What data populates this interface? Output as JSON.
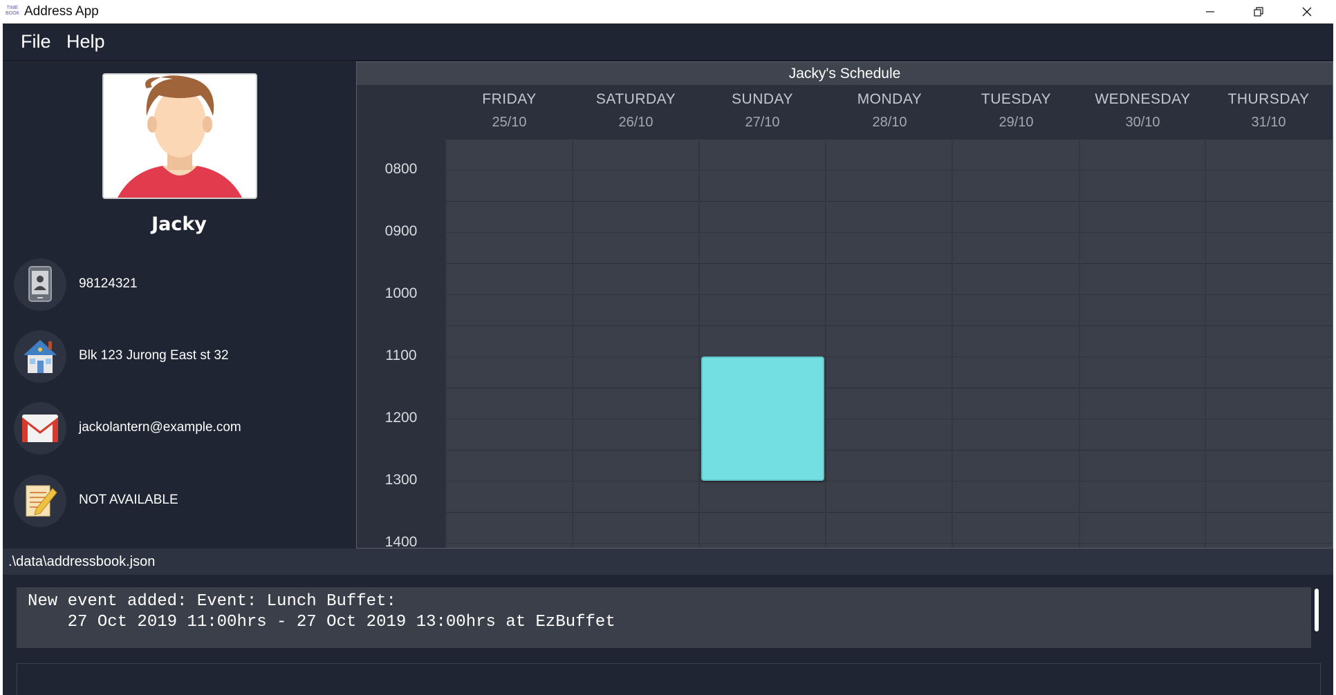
{
  "window": {
    "title": "Address App",
    "icon_text": "TIME BOOK"
  },
  "menu": {
    "file": "File",
    "help": "Help"
  },
  "person": {
    "name": "Jacky",
    "phone": "98124321",
    "address": "Blk 123 Jurong East st 32",
    "email": "jackolantern@example.com",
    "remark": "NOT AVAILABLE",
    "icons": [
      "phone-icon",
      "house-icon",
      "gmail-icon",
      "notepad-icon"
    ]
  },
  "schedule": {
    "title": "Jacky's Schedule",
    "days": [
      {
        "name": "FRIDAY",
        "date": "25/10"
      },
      {
        "name": "SATURDAY",
        "date": "26/10"
      },
      {
        "name": "SUNDAY",
        "date": "27/10"
      },
      {
        "name": "MONDAY",
        "date": "28/10"
      },
      {
        "name": "TUESDAY",
        "date": "29/10"
      },
      {
        "name": "WEDNESDAY",
        "date": "30/10"
      },
      {
        "name": "THURSDAY",
        "date": "31/10"
      }
    ],
    "times": [
      "0800",
      "0900",
      "1000",
      "1100",
      "1200",
      "1300",
      "1400"
    ],
    "events": [
      {
        "day": "SUNDAY",
        "start": "1100",
        "end": "1300",
        "color": "#74dfe2"
      }
    ]
  },
  "status": {
    "path": ".\\data\\addressbook.json"
  },
  "result": {
    "line1": "New event added: Event: Lunch Buffet:",
    "line2": "    27 Oct 2019 11:00hrs - 27 Oct 2019 13:00hrs at EzBuffet"
  },
  "colors": {
    "background": "#1f2533",
    "panel": "#3b3f49",
    "event": "#74dfe2"
  }
}
